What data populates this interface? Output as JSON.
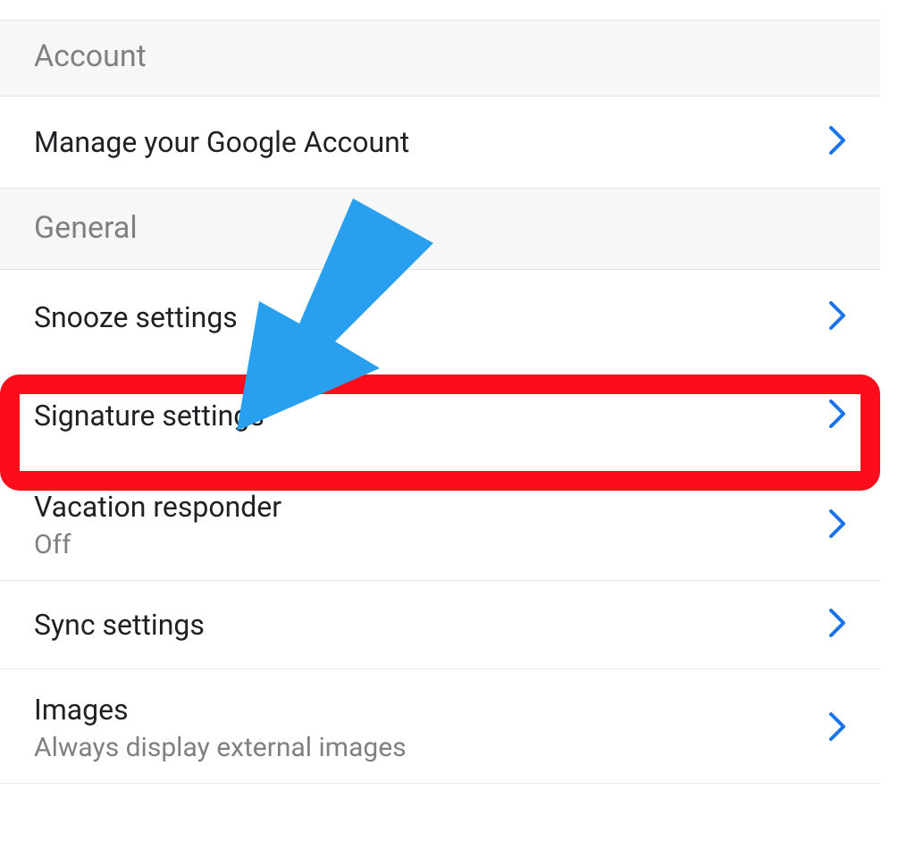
{
  "sections": {
    "account": {
      "header": "Account",
      "items": [
        {
          "label": "Manage your Google Account"
        }
      ]
    },
    "general": {
      "header": "General",
      "items": [
        {
          "label": "Snooze settings"
        },
        {
          "label": "Signature settings"
        },
        {
          "label": "Vacation responder",
          "subtitle": "Off"
        },
        {
          "label": "Sync settings"
        },
        {
          "label": "Images",
          "subtitle": "Always display external images"
        }
      ]
    }
  },
  "annotations": {
    "highlight_target": "Signature settings",
    "arrow_color": "#29a0ef",
    "highlight_color": "#fc0d1b"
  }
}
